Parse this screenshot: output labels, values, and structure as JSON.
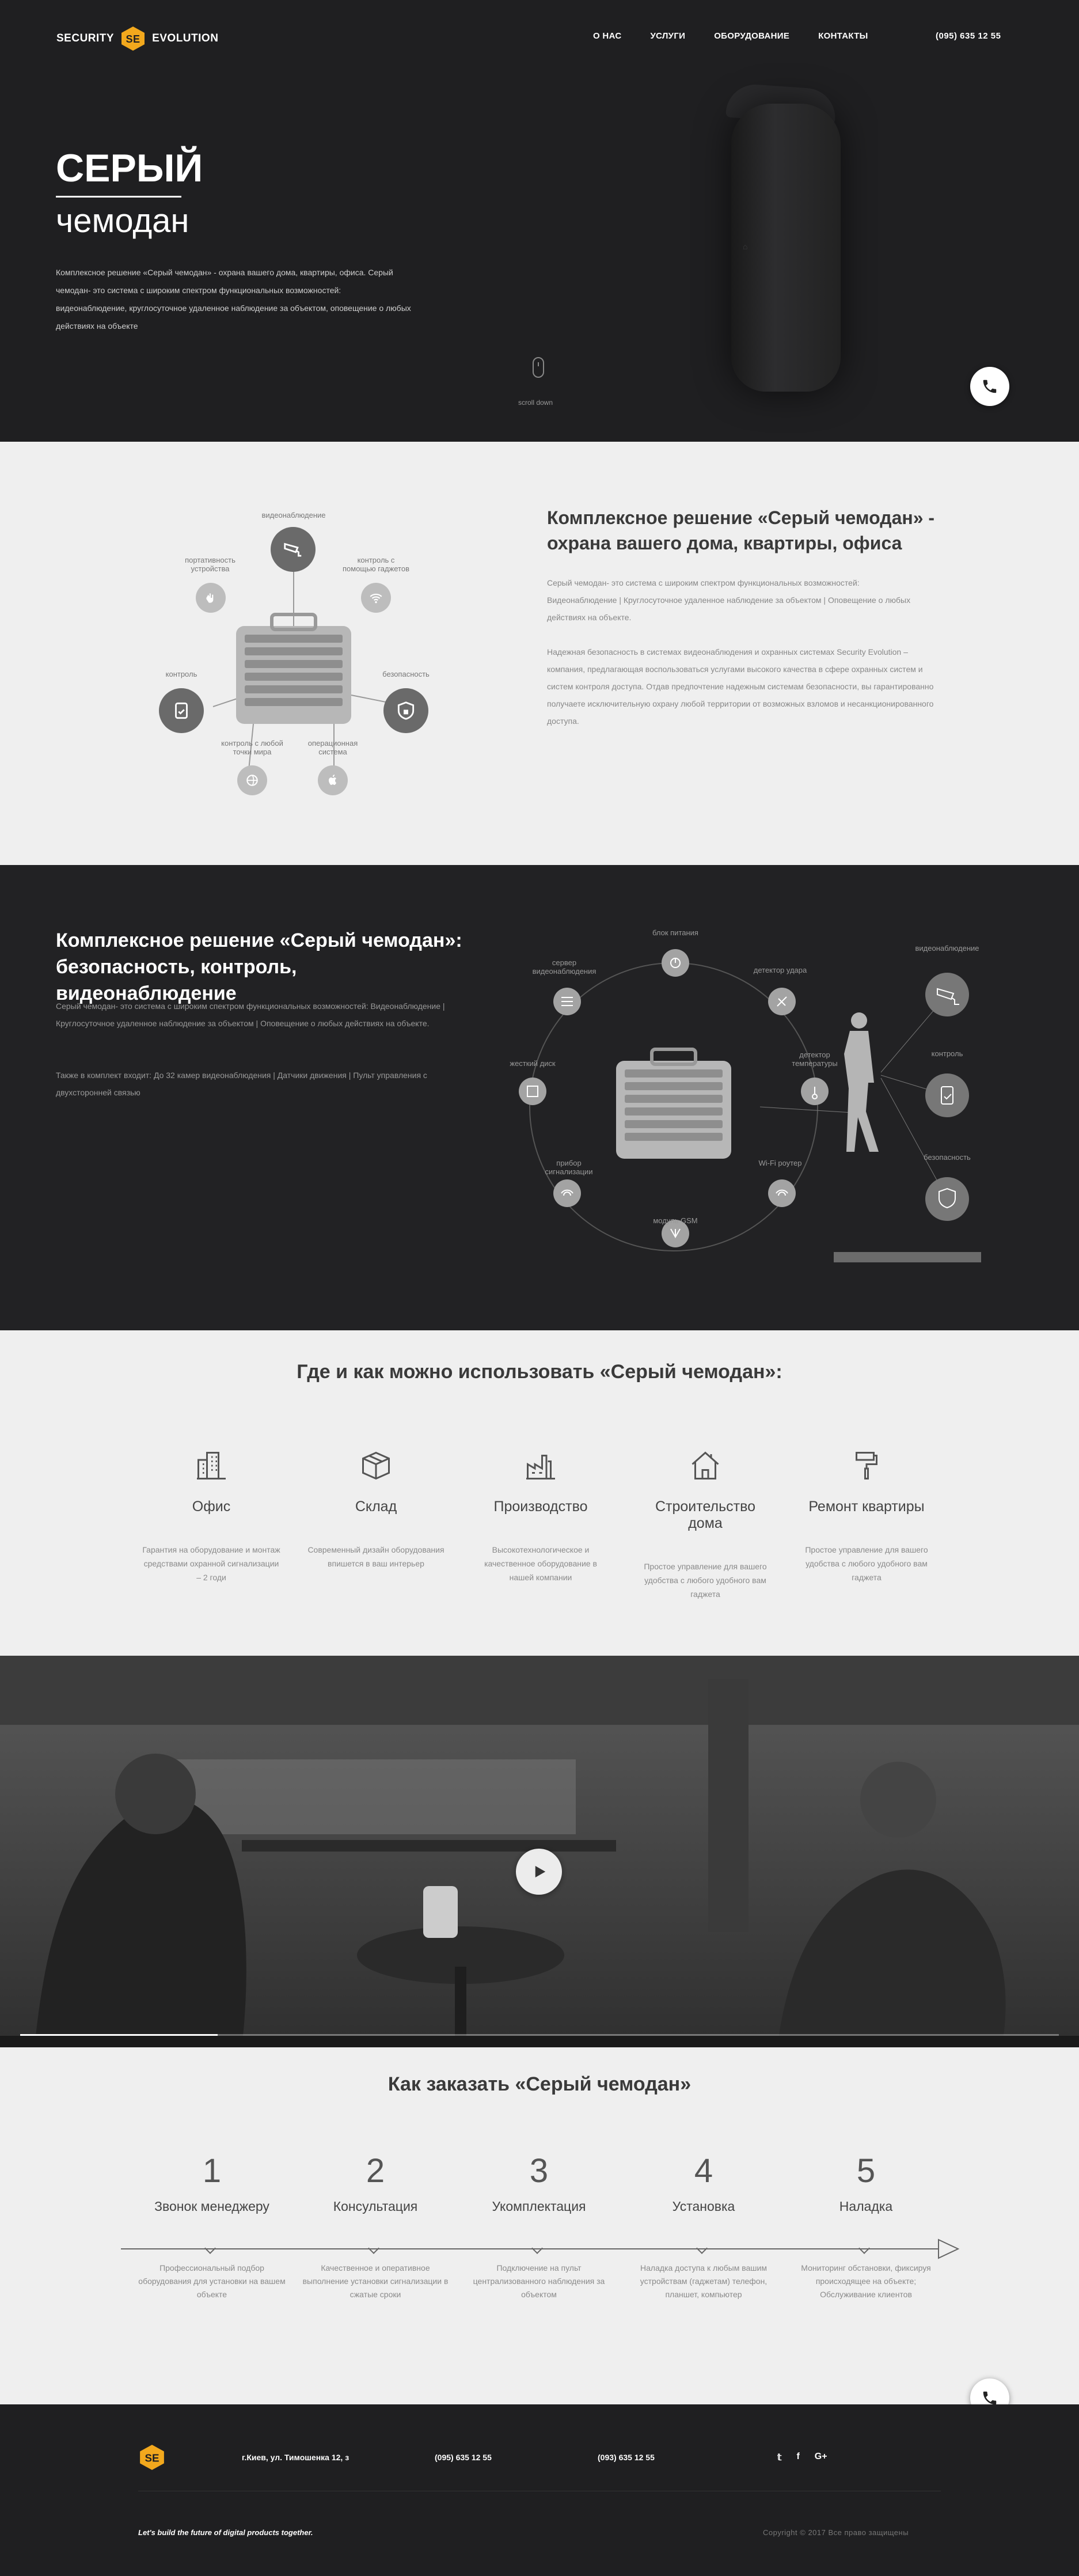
{
  "brand": {
    "left": "SECURITY",
    "right": "EVOLUTION",
    "badge": "SE",
    "accent": "#f2a81d"
  },
  "nav": {
    "items": [
      "О НАС",
      "УСЛУГИ",
      "ОБОРУДОВАНИЕ",
      "КОНТАКТЫ"
    ],
    "phone": "(095) 635 12 55"
  },
  "hero": {
    "title": "СЕРЫЙ",
    "subtitle": "чемодан",
    "desc": "Комплексное решение «Серый чемодан» - охрана вашего дома, квартиры, офиса. Серый чемодан- это система с широким спектром функциональных возможностей: видеонаблюдение, круглосуточное удаленное наблюдение за объектом, оповещение о любых действиях на объекте",
    "scroll": "scroll down"
  },
  "s2": {
    "title": "Комплексное решение «Серый чемодан» - охрана вашего дома, квартиры, офиса",
    "p1": "Серый чемодан- это система с широким спектром функциональных возможностей: Видеонаблюдение   |   Круглосуточное удаленное наблюдение за объектом   |   Оповещение о любых действиях на объекте.",
    "p2": "Надежная безопасность в системах видеонаблюдения и охранных системах Security Evolution – компания, предлагающая воспользоваться услугами высокого качества в сфере охранных систем и систем контроля доступа. Отдав предпочтение надежным системам безопасности, вы гарантированно получаете исключительную охрану любой территории от возможных взломов и несанкционированного доступа.",
    "labels": {
      "video": "видеонаблюдение",
      "portable": "портативность устройства",
      "gadgets": "контроль с помощью гаджетов",
      "control": "контроль",
      "security": "безопасность",
      "anywhere": "контроль с любой точки мира",
      "os": "операционная система"
    }
  },
  "s3": {
    "title": "Комплексное решение «Серый чемодан»: безопасность, контроль, видеонаблюдение",
    "p1": "Серый чемодан- это система с широким спектром функциональных возможностей: Видеонаблюдение   |   Круглосуточное удаленное наблюдение за объектом   |   Оповещение о любых действиях на объекте.",
    "p2": "Также в комплект входит: До 32 камер видеонаблюдения   |   Датчики движения   |   Пульт управления с двухсторонней связью",
    "labels": {
      "power": "блок питания",
      "shock": "детектор удара",
      "server": "сервер видеонаблюдения",
      "temp": "детектор температуры",
      "hdd": "жесткий диск",
      "alarm": "прибор сигнализации",
      "wifi": "Wi-Fi роутер",
      "gsm": "модуль GSM",
      "video": "видеонаблюдение",
      "control": "контроль",
      "security": "безопасность"
    }
  },
  "s4": {
    "title": "Где и как можно использовать «Серый чемодан»:",
    "cards": [
      {
        "title": "Офис",
        "desc": "Гарантия на оборудование и монтаж средствами охранной сигнализации – 2 годи"
      },
      {
        "title": "Склад",
        "desc": "Современный дизайн оборудования впишется в ваш интерьер"
      },
      {
        "title": "Производство",
        "desc": "Высокотехнологическое и качественное оборудование в нашей компании"
      },
      {
        "title": "Строительство дома",
        "desc": "Простое управление для вашего удобства с любого удобного вам гаджета"
      },
      {
        "title": "Ремонт квартиры",
        "desc": "Простое управление для вашего удобства с любого удобного вам гаджета"
      }
    ]
  },
  "s6": {
    "title": "Как заказать «Серый чемодан»",
    "steps": [
      {
        "n": "1",
        "title": "Звонок менеджеру",
        "desc": "Профессиональный подбор оборудования для установки на вашем объекте"
      },
      {
        "n": "2",
        "title": "Консультация",
        "desc": "Качественное и оперативное выполнение установки сигнализации в сжатые сроки"
      },
      {
        "n": "3",
        "title": "Укомплектация",
        "desc": "Подключение на пульт централизованного наблюдения за объектом"
      },
      {
        "n": "4",
        "title": "Установка",
        "desc": "Наладка доступа к любым вашим устройствам (гаджетам) телефон, планшет, компьютер"
      },
      {
        "n": "5",
        "title": "Наладка",
        "desc": "Мониторинг обстановки, фиксируя происходящее на объекте; Обслуживание клиентов"
      }
    ]
  },
  "footer": {
    "address": "г.Киев, ул. Тимошенка 12, з",
    "phone1": "(095) 635 12 55",
    "phone2": "(093) 635 12 55",
    "tagline": "Let's build the future of digital products together.",
    "copyright": "Copyright © 2017 Все право защищены"
  },
  "video": {
    "progress": 0.19
  }
}
